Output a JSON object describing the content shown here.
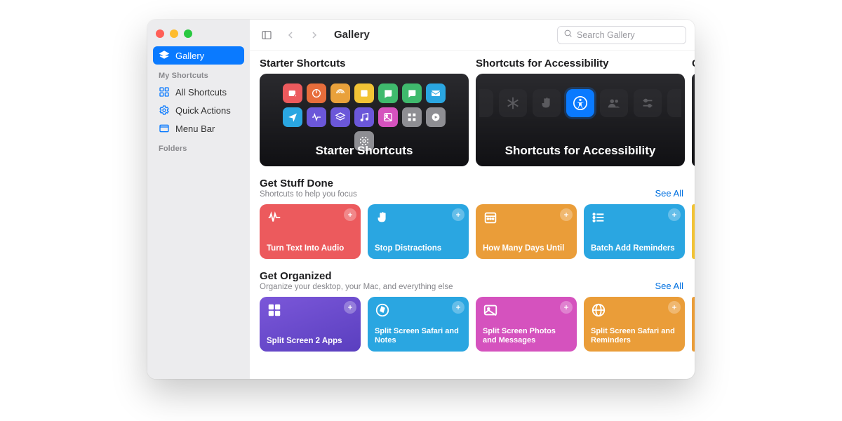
{
  "window_title": "Gallery",
  "search": {
    "placeholder": "Search Gallery"
  },
  "sidebar": {
    "gallery_label": "Gallery",
    "section_my": "My Shortcuts",
    "section_folders": "Folders",
    "items": [
      {
        "label": "All Shortcuts"
      },
      {
        "label": "Quick Actions"
      },
      {
        "label": "Menu Bar"
      }
    ]
  },
  "heroes": [
    {
      "head": "Starter Shortcuts",
      "title": "Starter Shortcuts"
    },
    {
      "head": "Shortcuts for Accessibility",
      "title": "Shortcuts for Accessibility"
    },
    {
      "head": "G"
    }
  ],
  "sections": [
    {
      "title": "Get Stuff Done",
      "subtitle": "Shortcuts to help you focus",
      "see_all": "See All",
      "cards": [
        {
          "label": "Turn Text Into Audio",
          "color": "#ec5a5d"
        },
        {
          "label": "Stop Distractions",
          "color": "#2aa6e1"
        },
        {
          "label": "How Many Days Until",
          "color": "#ea9d39"
        },
        {
          "label": "Batch Add Reminders",
          "color": "#2aa6e1"
        }
      ],
      "partial_color": "#f2c335"
    },
    {
      "title": "Get Organized",
      "subtitle": "Organize your desktop, your Mac, and everything else",
      "see_all": "See All",
      "cards": [
        {
          "label": "Split Screen 2 Apps",
          "color": "gradient-purple"
        },
        {
          "label": "Split Screen Safari and Notes",
          "color": "#2aa6e1"
        },
        {
          "label": "Split Screen Photos and Messages",
          "color": "#d552be"
        },
        {
          "label": "Split Screen Safari and Reminders",
          "color": "#ea9d39"
        }
      ],
      "partial_color": "#ea9d39"
    }
  ],
  "hero_chip_colors": [
    "#ec5a5d",
    "#e76d3b",
    "#e9a13b",
    "#f2c335",
    "#3fba6d",
    "#3fba6d",
    "#2aa6e1",
    "#2aa6e1",
    "#6b57d9",
    "#6b57d9",
    "#6b57d9",
    "#d552be",
    "#8e8e93",
    "#8e8e93",
    "#8e8e93"
  ]
}
